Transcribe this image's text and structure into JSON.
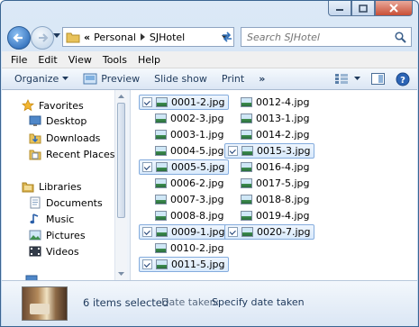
{
  "window": {
    "caption_buttons": [
      "minimize",
      "maximize",
      "close"
    ]
  },
  "address": {
    "overflow": "«",
    "crumbs": [
      "Personal",
      "SJHotel"
    ],
    "search_placeholder": "Search SJHotel"
  },
  "menu": [
    "File",
    "Edit",
    "View",
    "Tools",
    "Help"
  ],
  "toolbar": {
    "organize": "Organize",
    "preview": "Preview",
    "slideshow": "Slide show",
    "print": "Print",
    "more": "»"
  },
  "nav": {
    "favorites": "Favorites",
    "desktop": "Desktop",
    "downloads": "Downloads",
    "recent": "Recent Places",
    "libraries": "Libraries",
    "documents": "Documents",
    "music": "Music",
    "pictures": "Pictures",
    "videos": "Videos"
  },
  "files": [
    {
      "name": "0001-2.jpg",
      "selected": true
    },
    {
      "name": "0002-3.jpg",
      "selected": false
    },
    {
      "name": "0003-1.jpg",
      "selected": false
    },
    {
      "name": "0004-5.jpg",
      "selected": false
    },
    {
      "name": "0005-5.jpg",
      "selected": true
    },
    {
      "name": "0006-2.jpg",
      "selected": false
    },
    {
      "name": "0007-3.jpg",
      "selected": false
    },
    {
      "name": "0008-8.jpg",
      "selected": false
    },
    {
      "name": "0009-1.jpg",
      "selected": true
    },
    {
      "name": "0010-2.jpg",
      "selected": false
    },
    {
      "name": "0011-5.jpg",
      "selected": true
    },
    {
      "name": "0012-4.jpg",
      "selected": false
    },
    {
      "name": "0013-1.jpg",
      "selected": false
    },
    {
      "name": "0014-2.jpg",
      "selected": false
    },
    {
      "name": "0015-3.jpg",
      "selected": true
    },
    {
      "name": "0016-4.jpg",
      "selected": false
    },
    {
      "name": "0017-5.jpg",
      "selected": false
    },
    {
      "name": "0018-8.jpg",
      "selected": false
    },
    {
      "name": "0019-4.jpg",
      "selected": false
    },
    {
      "name": "0020-7.jpg",
      "selected": true
    }
  ],
  "details": {
    "count": "6 items selected",
    "date_label": "Date taken:",
    "date_value": "Specify date taken"
  },
  "colors": {
    "selection_border": "#84acdd",
    "toolbar_text": "#1e395b"
  }
}
